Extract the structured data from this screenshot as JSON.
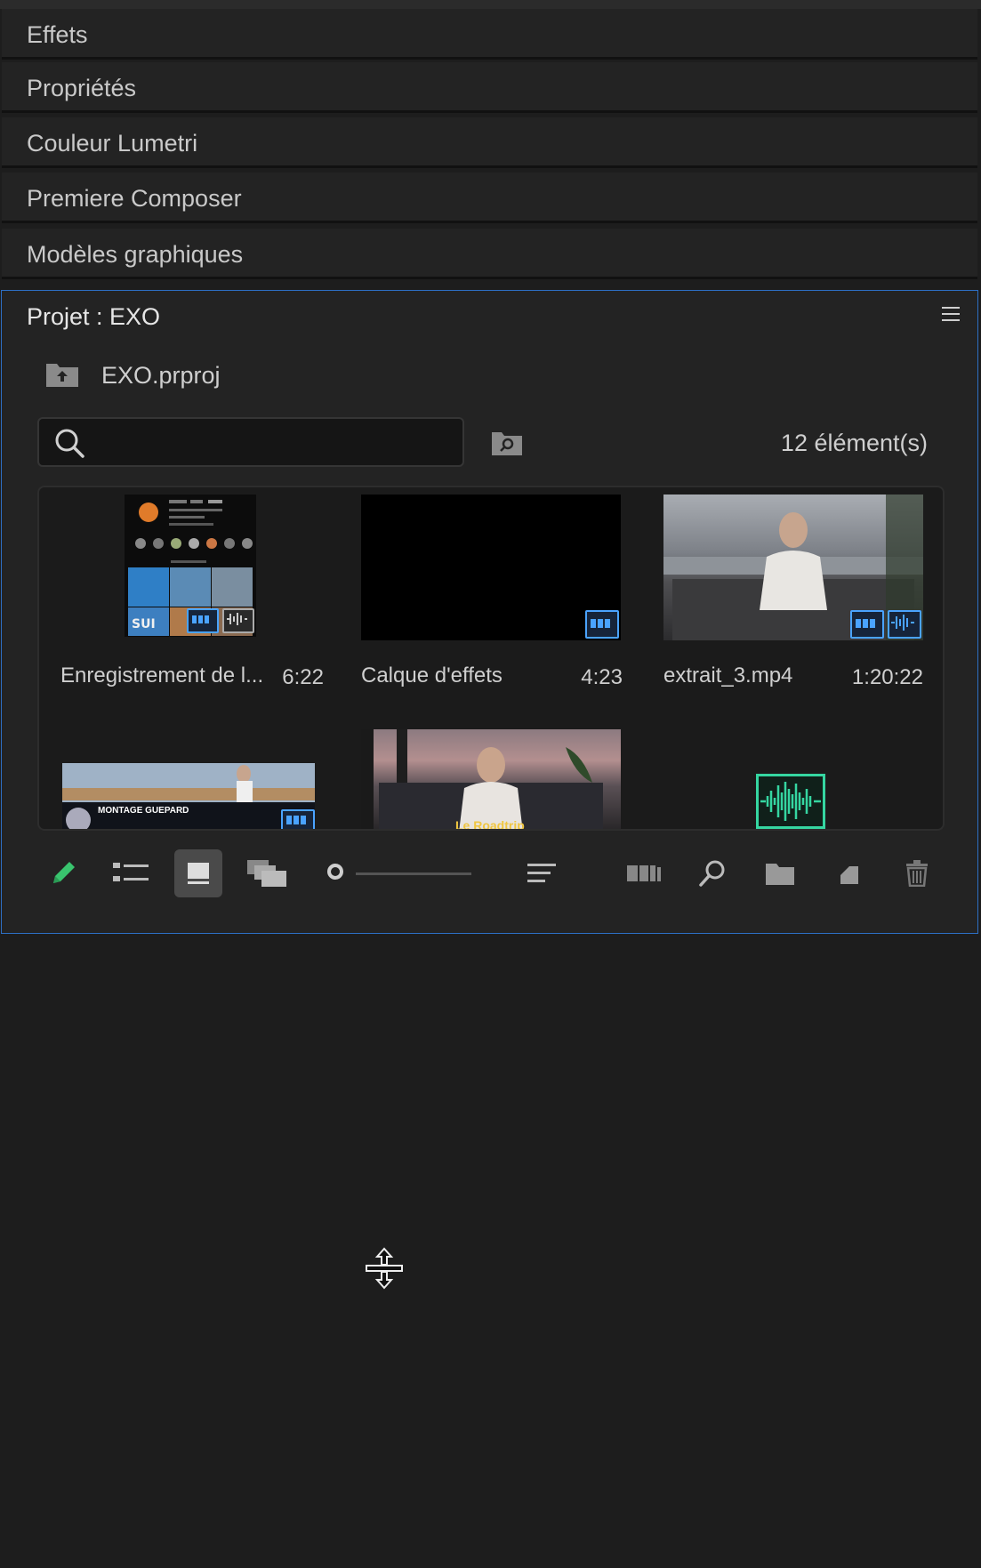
{
  "panels": [
    {
      "label": "Effets"
    },
    {
      "label": "Propriétés"
    },
    {
      "label": "Couleur Lumetri"
    },
    {
      "label": "Premiere Composer"
    },
    {
      "label": "Modèles graphiques"
    }
  ],
  "project": {
    "title": "Projet : EXO",
    "file": "EXO.prproj",
    "search_placeholder": "",
    "item_count": "12 élément(s)",
    "items": [
      {
        "name": "Enregistrement de l...",
        "duration": "6:22",
        "badges": [
          "video",
          "audio"
        ]
      },
      {
        "name": "Calque d'effets",
        "duration": "4:23",
        "badges": [
          "video"
        ]
      },
      {
        "name": "extrait_3.mp4",
        "duration": "1:20:22",
        "badges": [
          "video",
          "audio"
        ]
      },
      {
        "name": "",
        "duration": "",
        "badges": [
          "video"
        ],
        "overlay_text": "MONTAGE GUEPARD"
      },
      {
        "name": "",
        "duration": "",
        "badges": [],
        "overlay_text": "Le Roadtrip"
      },
      {
        "name": "",
        "duration": "",
        "badges": [
          "audio"
        ]
      }
    ]
  },
  "toolbar": {
    "icons": [
      "pencil-icon",
      "list-view-icon",
      "icon-view-icon",
      "freeform-view-icon",
      "zoom-slider",
      "sort-icon",
      "automate-to-sequence-icon",
      "find-icon",
      "new-bin-icon",
      "new-item-icon",
      "trash-icon"
    ],
    "active": "icon-view-icon",
    "accent": "#39c46e"
  },
  "colors": {
    "selection": "#2d6fc4",
    "badge": "#4aa3ff",
    "waveform": "#35d6a1"
  }
}
